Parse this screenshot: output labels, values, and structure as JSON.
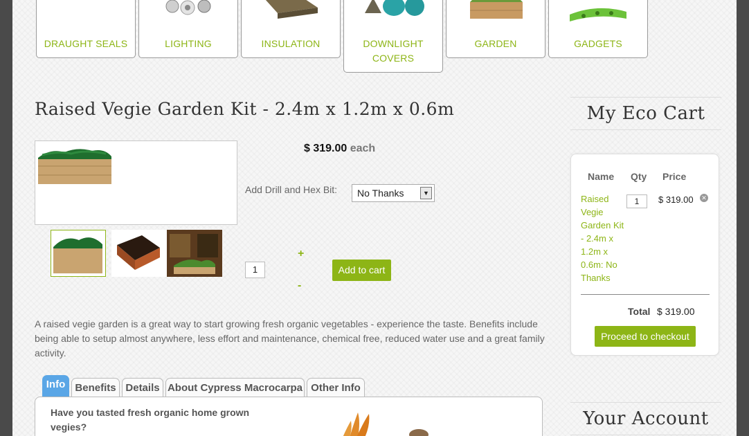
{
  "categories": [
    {
      "label": "DRAUGHT SEALS",
      "icon": "draught-seals-image"
    },
    {
      "label": "LIGHTING",
      "icon": "lighting-image"
    },
    {
      "label": "INSULATION",
      "icon": "insulation-image"
    },
    {
      "label": "DOWNLIGHT COVERS",
      "icon": "downlight-covers-image"
    },
    {
      "label": "GARDEN",
      "icon": "garden-image"
    },
    {
      "label": "GADGETS",
      "icon": "gadgets-image"
    }
  ],
  "product": {
    "title": "Raised Vegie Garden Kit - 2.4m x 1.2m x 0.6m",
    "price": "$ 319.00",
    "price_unit": "each",
    "option_label": "Add Drill and Hex Bit:",
    "option_value": "No Thanks",
    "quantity": "1",
    "plus": "+",
    "minus": "-",
    "add_to_cart": "Add to cart",
    "description": "A raised vegie garden is a great way to start growing fresh organic vegetables - experience the taste. Benefits include being able to setup almost anywhere, less effort and maintenance, chemical free, reduced water use and a great family activity."
  },
  "tabs": [
    {
      "label": "Info",
      "active": true
    },
    {
      "label": "Benefits",
      "active": false
    },
    {
      "label": "Details",
      "active": false
    },
    {
      "label": "About Cypress Macrocarpa",
      "active": false
    },
    {
      "label": "Other Info",
      "active": false
    }
  ],
  "tab_panel": {
    "heading": "Have you tasted fresh organic home grown vegies?"
  },
  "cart": {
    "title": "My Eco Cart",
    "col_name": "Name",
    "col_qty": "Qty",
    "col_price": "Price",
    "item_name": "Raised Vegie Garden Kit - 2.4m x 1.2m x 0.6m: No Thanks",
    "item_qty": "1",
    "item_price": "$ 319.00",
    "total_label": "Total",
    "total_value": "$ 319.00",
    "checkout": "Proceed to checkout"
  },
  "account": {
    "title": "Your Account"
  },
  "colors": {
    "accent": "#8db516",
    "tab_active": "#5aa6e6"
  }
}
